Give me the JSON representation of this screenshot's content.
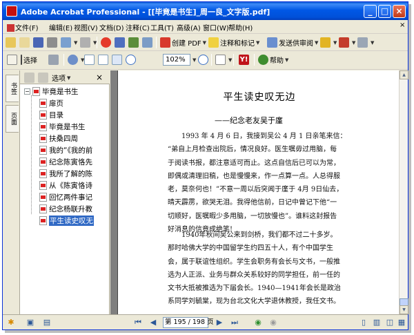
{
  "window": {
    "title": "Adobe Acrobat Professional - [[毕竟是书生]_周一良_文字版.pdf]"
  },
  "menu": [
    "文件(F)",
    "编辑(E)",
    "视图(V)",
    "文档(D)",
    "注释(C)",
    "工具(T)",
    "高级(A)",
    "窗口(W)",
    "帮助(H)"
  ],
  "toolbar1": {
    "create_pdf": "创建 PDF",
    "comment_markup": "注释和标记",
    "send_review": "发送供审阅"
  },
  "toolbar2": {
    "select": "选择",
    "zoom": "102%",
    "help": "帮助"
  },
  "nav_tabs": [
    "书签",
    "页面"
  ],
  "bookmarks_panel": {
    "options_label": "选项",
    "items": [
      {
        "label": "毕竟是书生",
        "level": 0
      },
      {
        "label": "扉页",
        "level": 1
      },
      {
        "label": "目录",
        "level": 1
      },
      {
        "label": "毕竟是书生",
        "level": 1
      },
      {
        "label": "扶桑四周",
        "level": 1
      },
      {
        "label": "我的“《我的前",
        "level": 1
      },
      {
        "label": "纪念陈寅恪先",
        "level": 1
      },
      {
        "label": "我所了解的陈",
        "level": 1
      },
      {
        "label": "从《陈寅恪诗",
        "level": 1
      },
      {
        "label": "回忆两件事记",
        "level": 1
      },
      {
        "label": "纪念杨联升教",
        "level": 1
      },
      {
        "label": "平生读史叹无",
        "level": 1,
        "selected": true
      }
    ]
  },
  "document": {
    "title": "平生读史叹无边",
    "subtitle": "——纪念老友吴于廑",
    "para1_lines": [
      "1993 年 4 月 6 日，我接到吴公 4 月 1 日亲笔来信：",
      "“弟自上月检查出院后，情况良好。医生嘱毋过用脑，每",
      "于阅读书报，都注意适可而止。这点自信后已可以为常，",
      "即偶或清理旧稿，也是慢慢来，作一点算一点。人总得服",
      "老，莫奈何也！”不意一周以后突闻于廑于 4月 9日仙去，",
      "晴天霹雳，欲哭无泪。我得他信前，日记中曾记下他“一",
      "切顺好，医嘱暇少多用脑，一切放慢也”。谁料这封报告",
      "好消息的信竟成绝笔!"
    ],
    "para2_lines": [
      "1940年秋间吴公来到剑桥，我们都不过二十多岁。",
      "那时哈佛大学的中国留学生约四五十人，有个中国学生",
      "会，属于联谊性组织。学生会职务有会长与文书，一般推",
      "选为人正派、业务与群众关系较好的同学担任，前一任的",
      "文书大抵被推选为下届会长。1940—1941年会长是政治",
      "系同学刘毓棠，现为台北文化大学退休教授，我任文书。"
    ]
  },
  "statusbar": {
    "page_info": "第 195 / 198 页"
  }
}
